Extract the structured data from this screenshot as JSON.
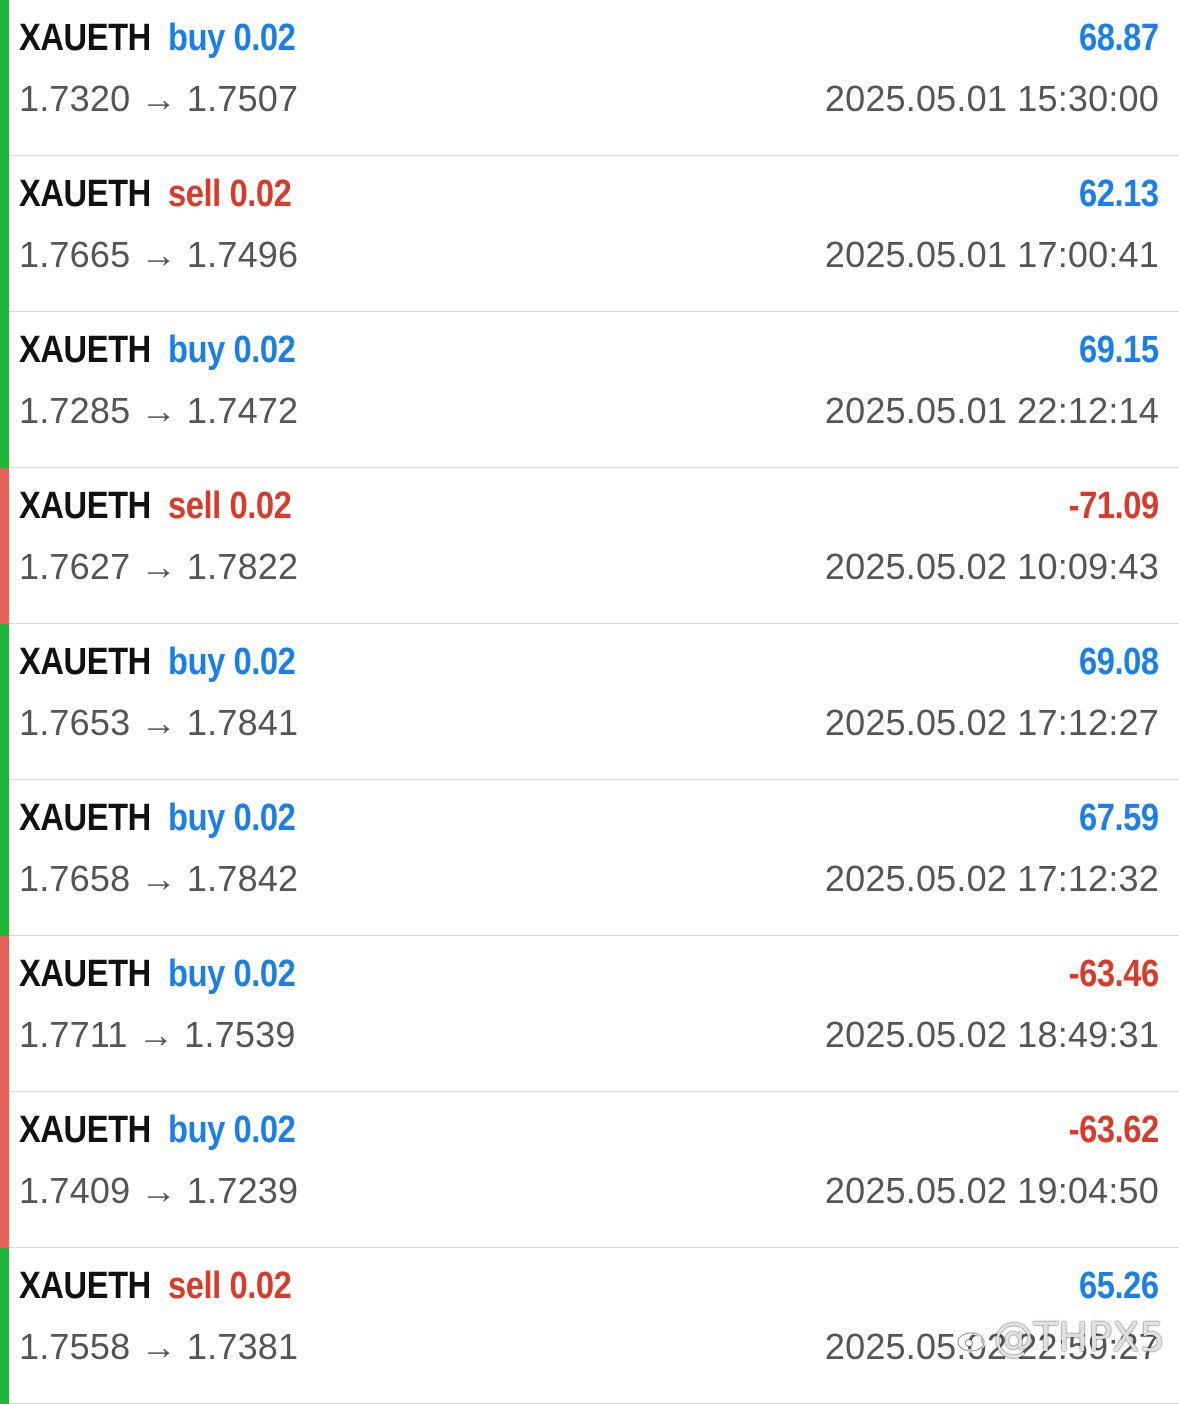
{
  "colors": {
    "buy": "#1a7fe6",
    "sell": "#d93b2b",
    "profit_positive": "#1a7fe6",
    "profit_negative": "#d93b2b",
    "bar_win": "#1fb83a",
    "bar_loss": "#e8605a"
  },
  "trades": [
    {
      "symbol": "XAUETH",
      "side": "buy",
      "lot": "0.02",
      "open_price": "1.7320",
      "close_price": "1.7507",
      "time": "2025.05.01 15:30:00",
      "profit": "68.87"
    },
    {
      "symbol": "XAUETH",
      "side": "sell",
      "lot": "0.02",
      "open_price": "1.7665",
      "close_price": "1.7496",
      "time": "2025.05.01 17:00:41",
      "profit": "62.13"
    },
    {
      "symbol": "XAUETH",
      "side": "buy",
      "lot": "0.02",
      "open_price": "1.7285",
      "close_price": "1.7472",
      "time": "2025.05.01 22:12:14",
      "profit": "69.15"
    },
    {
      "symbol": "XAUETH",
      "side": "sell",
      "lot": "0.02",
      "open_price": "1.7627",
      "close_price": "1.7822",
      "time": "2025.05.02 10:09:43",
      "profit": "-71.09"
    },
    {
      "symbol": "XAUETH",
      "side": "buy",
      "lot": "0.02",
      "open_price": "1.7653",
      "close_price": "1.7841",
      "time": "2025.05.02 17:12:27",
      "profit": "69.08"
    },
    {
      "symbol": "XAUETH",
      "side": "buy",
      "lot": "0.02",
      "open_price": "1.7658",
      "close_price": "1.7842",
      "time": "2025.05.02 17:12:32",
      "profit": "67.59"
    },
    {
      "symbol": "XAUETH",
      "side": "buy",
      "lot": "0.02",
      "open_price": "1.7711",
      "close_price": "1.7539",
      "time": "2025.05.02 18:49:31",
      "profit": "-63.46"
    },
    {
      "symbol": "XAUETH",
      "side": "buy",
      "lot": "0.02",
      "open_price": "1.7409",
      "close_price": "1.7239",
      "time": "2025.05.02 19:04:50",
      "profit": "-63.62"
    },
    {
      "symbol": "XAUETH",
      "side": "sell",
      "lot": "0.02",
      "open_price": "1.7558",
      "close_price": "1.7381",
      "time": "2025.05.02 22:59:27",
      "profit": "65.26"
    }
  ],
  "price_arrow": "→",
  "watermark": {
    "icon": "weibo-icon",
    "text": "@THPX5"
  }
}
